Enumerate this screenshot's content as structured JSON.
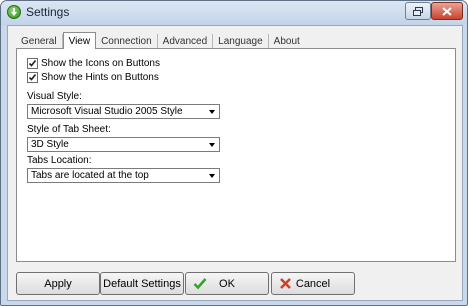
{
  "window": {
    "title": "Settings"
  },
  "tabs": [
    {
      "label": "General",
      "active": false
    },
    {
      "label": "View",
      "active": true
    },
    {
      "label": "Connection",
      "active": false
    },
    {
      "label": "Advanced",
      "active": false
    },
    {
      "label": "Language",
      "active": false
    },
    {
      "label": "About",
      "active": false
    }
  ],
  "view": {
    "show_icons": {
      "label": "Show the Icons on Buttons",
      "checked": true
    },
    "show_hints": {
      "label": "Show the Hints on Buttons",
      "checked": true
    },
    "visual_style": {
      "label": "Visual Style:",
      "value": "Microsoft Visual Studio 2005 Style"
    },
    "tab_sheet_style": {
      "label": "Style of Tab Sheet:",
      "value": "3D Style"
    },
    "tabs_location": {
      "label": "Tabs Location:",
      "value": "Tabs are located at the top"
    }
  },
  "buttons": {
    "apply": "Apply",
    "default_settings": "Default Settings",
    "ok": "OK",
    "cancel": "Cancel"
  },
  "icons": {
    "app": "download-arrow-icon",
    "ok": "checkmark-icon",
    "cancel": "x-icon"
  },
  "colors": {
    "ok_icon": "#2fa52a",
    "cancel_icon": "#d0402a"
  }
}
